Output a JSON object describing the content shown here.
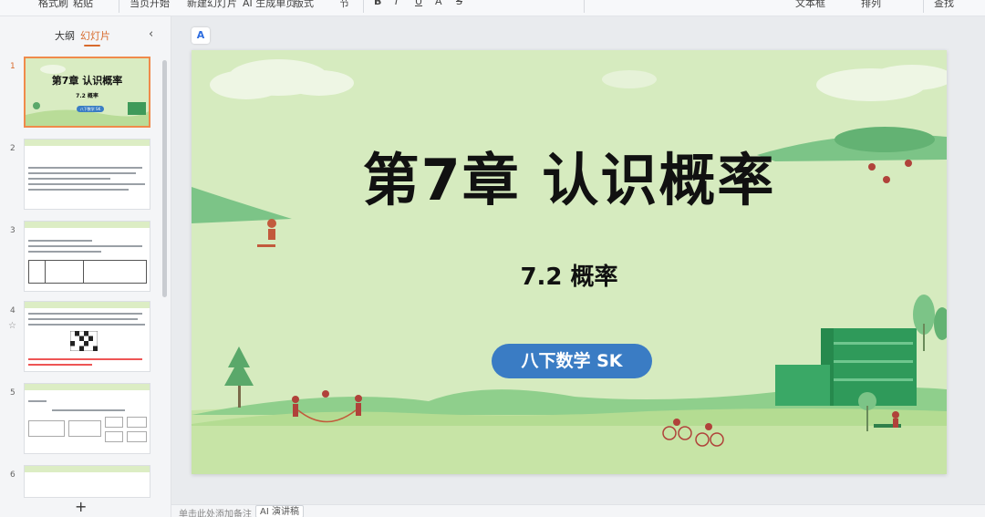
{
  "ribbon": {
    "items": [
      "格式刷",
      "粘贴",
      "当页开始",
      "新建幻灯片",
      "AI 生成单页",
      "版式",
      "节",
      "B",
      "I",
      "U",
      "A",
      "S",
      "文本框",
      "排列",
      "查找"
    ]
  },
  "left_panel": {
    "tabs": {
      "outline": "大纲",
      "slides": "幻灯片"
    },
    "collapse_icon": "chevron-left",
    "add_slide": "+",
    "thumbnails": [
      {
        "num": "1",
        "title": "第7章 认识概率",
        "sub": "7.2 概率",
        "badge": "八下数学 SK"
      },
      {
        "num": "2"
      },
      {
        "num": "3"
      },
      {
        "num": "4"
      },
      {
        "num": "5"
      },
      {
        "num": "6"
      }
    ]
  },
  "slide": {
    "title": "第7章  认识概率",
    "subtitle": "7.2  概率",
    "badge": "八下数学 SK",
    "background_color": "#d6ebbf",
    "badge_color": "#3a7cc4"
  },
  "bottom_bar": {
    "notes_placeholder": "单击此处添加备注",
    "ai_speech": "AI 演讲稿"
  }
}
